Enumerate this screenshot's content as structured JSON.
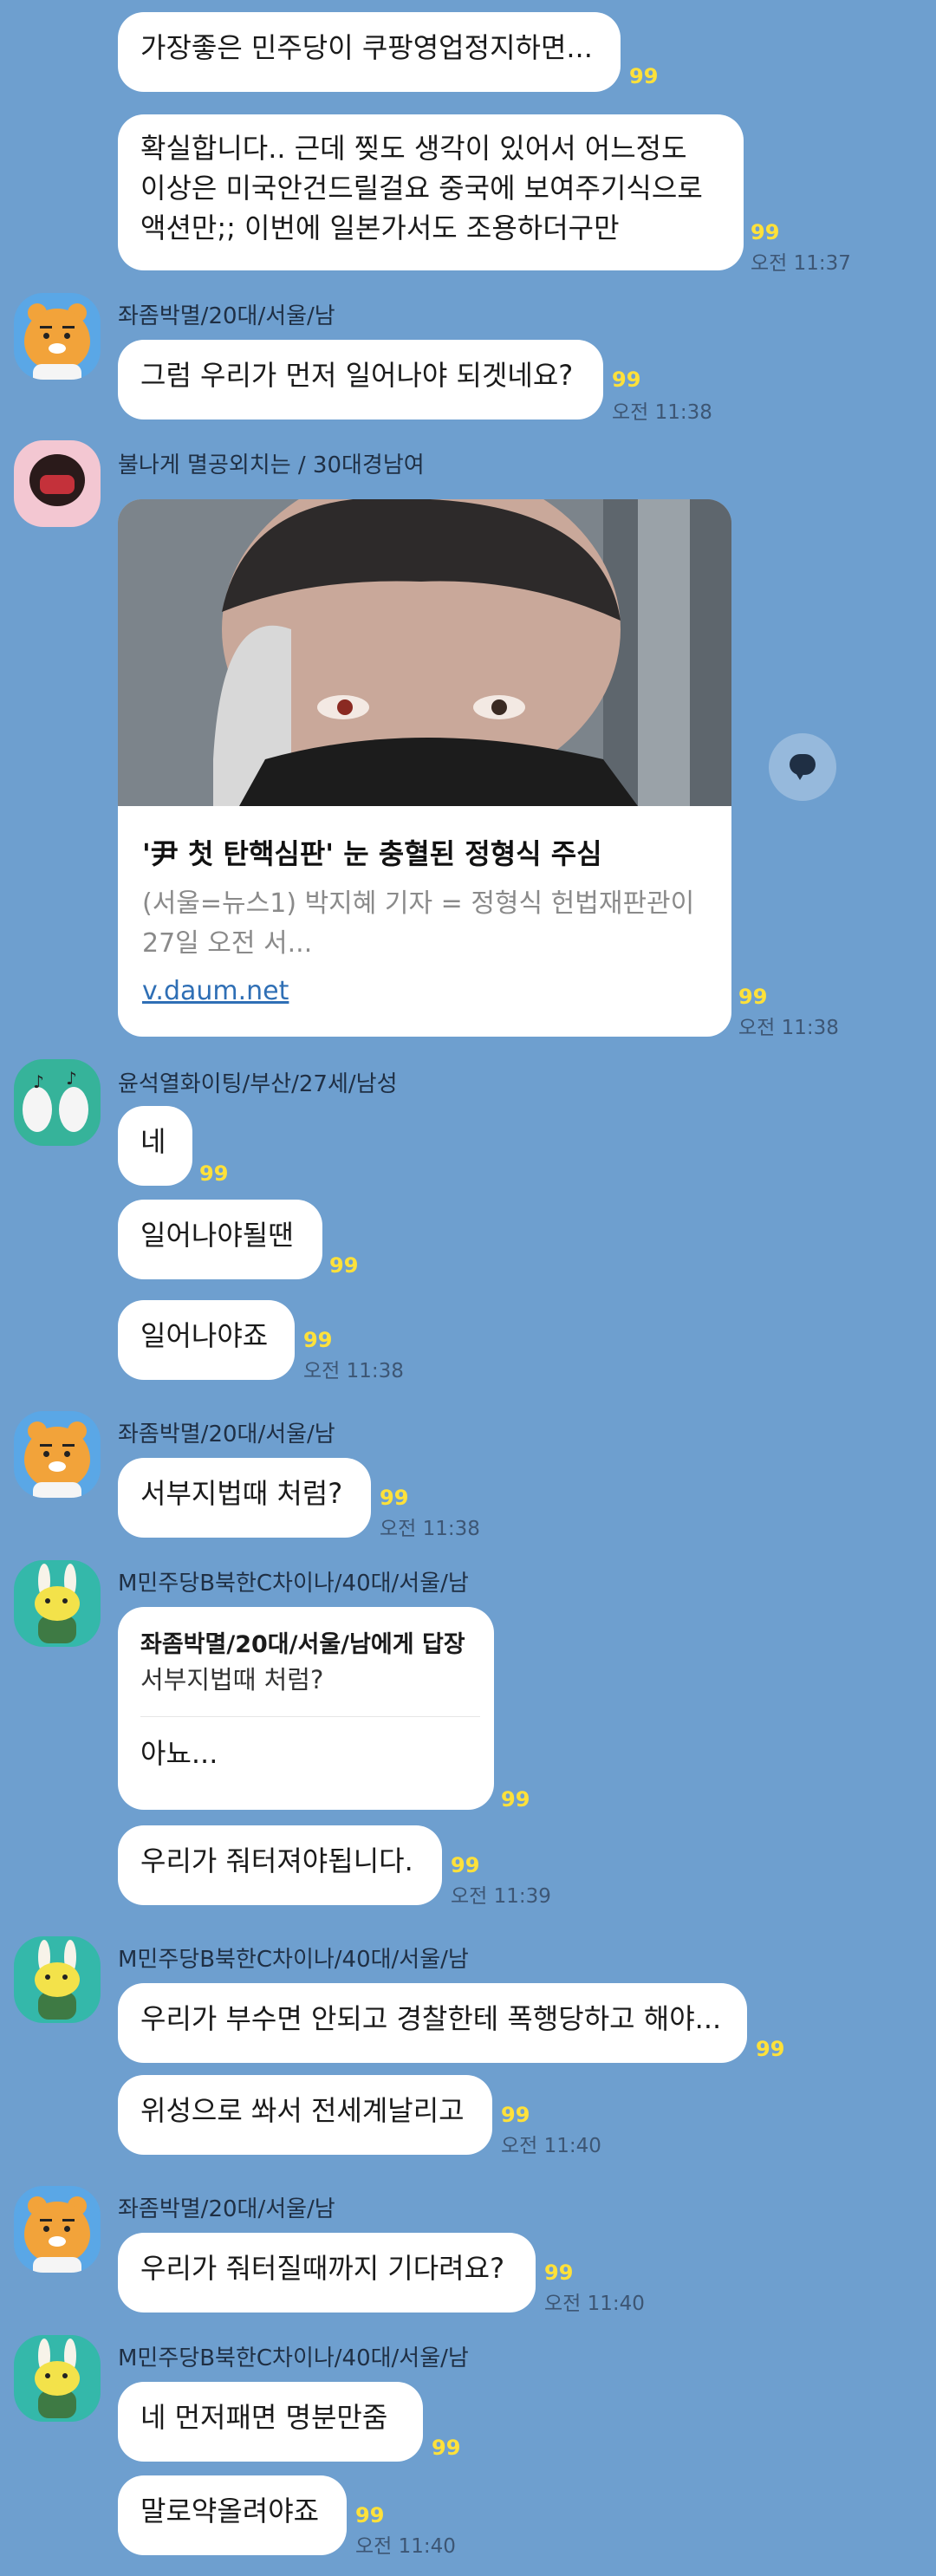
{
  "messages": {
    "m1": {
      "text": "가장좋은 민주당이 쿠팡영업정지하면...",
      "unread": "99"
    },
    "m2": {
      "text": "확실합니다.. 근데 찢도 생각이 있어서 어느정도 이상은 미국안건드릴걸요 중국에 보여주기식으로 액션만;; 이번에 일본가서도 조용하더구만",
      "unread": "99",
      "time": "오전 11:37"
    },
    "m3": {
      "sender": "좌좀박멸/20대/서울/남",
      "text": "그럼 우리가 먼저 일어나야 되겟네요?",
      "unread": "99",
      "time": "오전 11:38"
    },
    "m4": {
      "sender": "불나게 멸공외치는 / 30대경남여",
      "unread": "99",
      "time": "오전 11:38",
      "card": {
        "title": "'尹 첫 탄핵심판' 눈 충혈된 정형식 주심",
        "desc": "(서울=뉴스1) 박지혜 기자 = 정형식 헌법재판관이 27일 오전 서...",
        "link": "v.daum.net"
      }
    },
    "m5": {
      "sender": "윤석열화이팅/부산/27세/남성",
      "text": "네",
      "unread": "99"
    },
    "m6": {
      "text": "일어나야될땐",
      "unread": "99"
    },
    "m7": {
      "text": "일어나야죠",
      "unread": "99",
      "time": "오전 11:38"
    },
    "m8": {
      "sender": "좌좀박멸/20대/서울/남",
      "text": "서부지법때 처럼?",
      "unread": "99",
      "time": "오전 11:38"
    },
    "m9": {
      "sender": "M민주당B북한C차이나/40대/서울/남",
      "reply_to": "좌좀박멸/20대/서울/남에게 답장",
      "reply_orig": "서부지법때 처럼?",
      "text": "아뇨...",
      "unread": "99"
    },
    "m10": {
      "text": "우리가 줘터져야됩니다.",
      "unread": "99",
      "time": "오전 11:39"
    },
    "m11": {
      "sender": "M민주당B북한C차이나/40대/서울/남",
      "text": "우리가 부수면 안되고 경찰한테 폭행당하고 해야...",
      "unread": "99"
    },
    "m12": {
      "text": "위성으로 쏴서 전세계날리고",
      "unread": "99",
      "time": "오전 11:40"
    },
    "m13": {
      "sender": "좌좀박멸/20대/서울/남",
      "text": "우리가 줘터질때까지 기다려요?",
      "unread": "99",
      "time": "오전 11:40"
    },
    "m14": {
      "sender": "M민주당B북한C차이나/40대/서울/남",
      "text": "네 먼저패면 명분만줌",
      "unread": "99"
    },
    "m15": {
      "text": "말로약올려야죠",
      "unread": "99",
      "time": "오전 11:40"
    }
  },
  "icons": {
    "share": "speech-bubble-share-icon",
    "avatar_ryan": "ryan-bear-avatar",
    "avatar_pink": "pink-character-avatar",
    "avatar_teal": "penguin-pair-avatar",
    "avatar_muzi": "muzi-rabbit-avatar"
  },
  "colors": {
    "background": "#6e9fcf",
    "bubble": "#ffffff",
    "unread": "#ffe13a",
    "link": "#2f6fb5"
  }
}
